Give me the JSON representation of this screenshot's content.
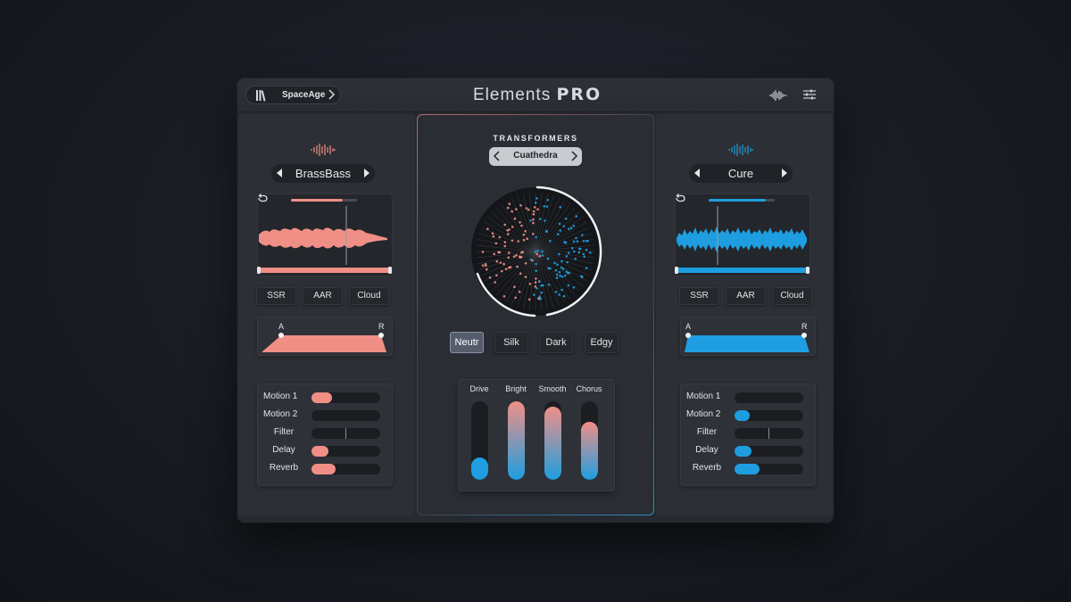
{
  "header": {
    "preset_name": "SpaceAge",
    "logo_main": "Elements",
    "logo_suffix": "PRO"
  },
  "colors": {
    "left_accent": "#f08f86",
    "right_accent": "#1e9ee0",
    "panel": "#2c2f35",
    "background": "#1a1d23"
  },
  "left": {
    "sample_name": "BrassBass",
    "modes": [
      "SSR",
      "AAR",
      "Cloud"
    ],
    "envelope": {
      "attack_label": "A",
      "release_label": "R"
    },
    "motion": [
      {
        "label": "Motion 1",
        "value": 0.3
      },
      {
        "label": "Motion 2",
        "value": 0
      },
      {
        "label": "Filter",
        "value": 0.5
      },
      {
        "label": "Delay",
        "value": 0.25
      },
      {
        "label": "Reverb",
        "value": 0.35
      }
    ]
  },
  "right": {
    "sample_name": "Cure",
    "modes": [
      "SSR",
      "AAR",
      "Cloud"
    ],
    "envelope": {
      "attack_label": "A",
      "release_label": "R"
    },
    "motion": [
      {
        "label": "Motion 1",
        "value": 0
      },
      {
        "label": "Motion 2",
        "value": 0.22
      },
      {
        "label": "Filter",
        "value": 0.5
      },
      {
        "label": "Delay",
        "value": 0.25
      },
      {
        "label": "Reverb",
        "value": 0.37
      }
    ]
  },
  "center": {
    "title": "TRANSFORMERS",
    "transformer": "Cuathedra",
    "tones": [
      {
        "label": "Neutr",
        "active": true
      },
      {
        "label": "Silk",
        "active": false
      },
      {
        "label": "Dark",
        "active": false
      },
      {
        "label": "Edgy",
        "active": false
      }
    ],
    "faders": [
      {
        "label": "Drive",
        "value": 0.28
      },
      {
        "label": "Bright",
        "value": 1.0
      },
      {
        "label": "Smooth",
        "value": 0.93
      },
      {
        "label": "Chorus",
        "value": 0.74
      }
    ]
  }
}
